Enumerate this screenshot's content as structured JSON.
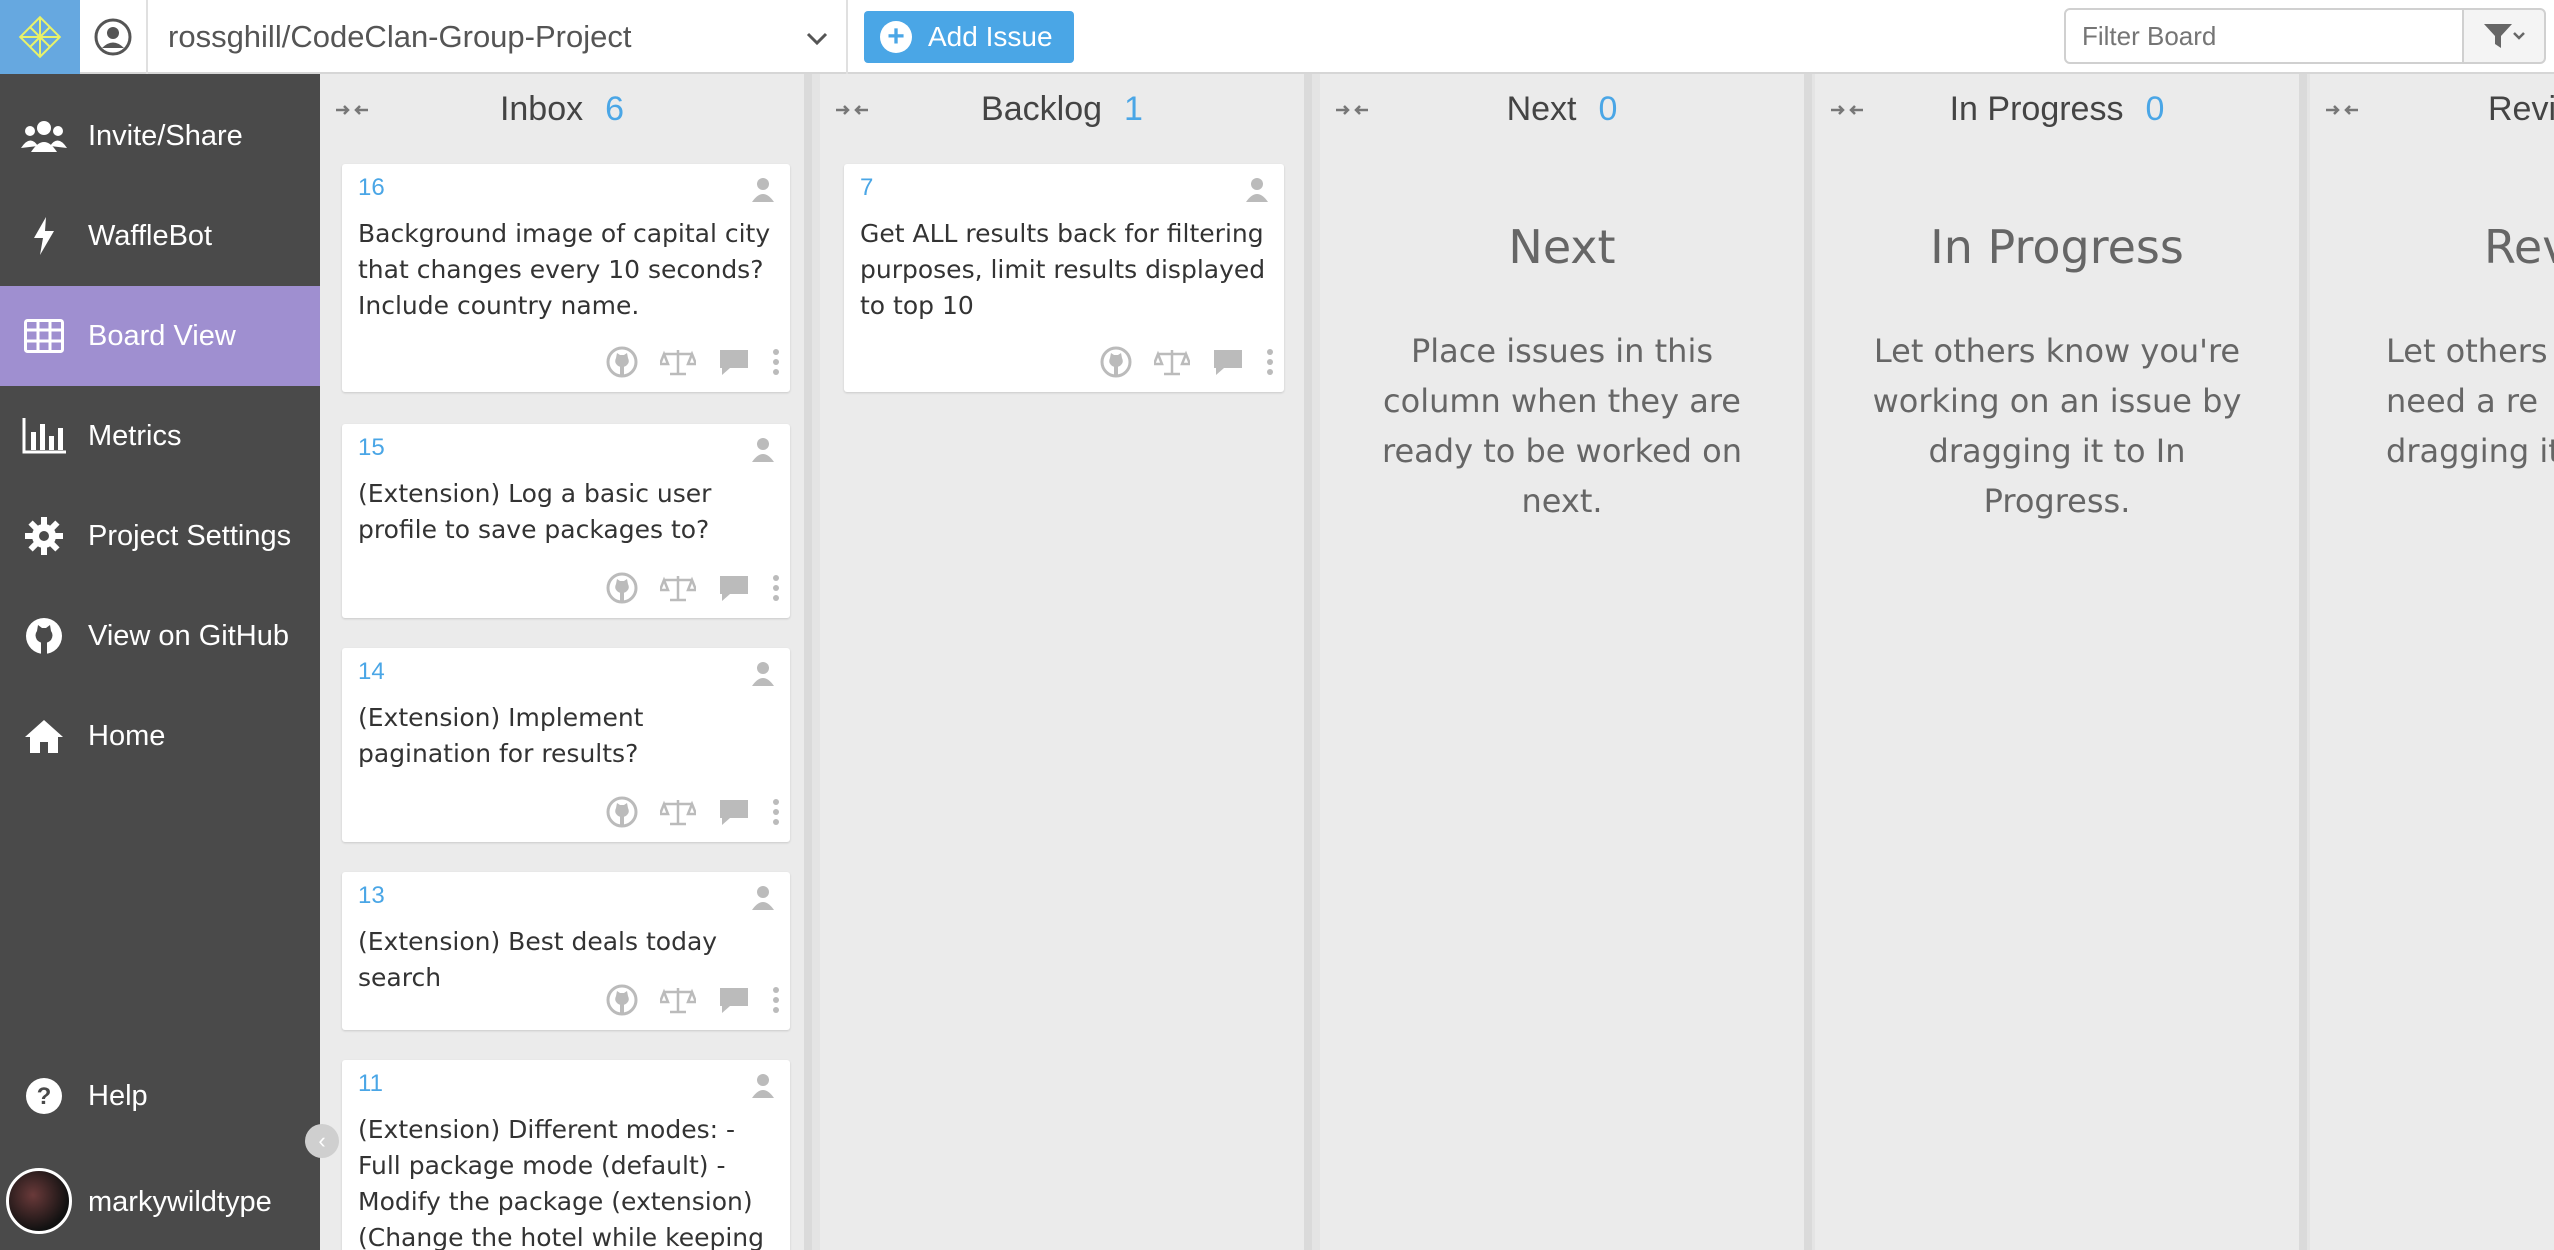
{
  "header": {
    "repo_name": "rossghill/CodeClan-Group-Project",
    "add_issue_label": "Add Issue",
    "filter_placeholder": "Filter Board"
  },
  "sidebar": {
    "items": [
      {
        "label": "Invite/Share",
        "icon": "users-icon"
      },
      {
        "label": "WaffleBot",
        "icon": "lightning-icon"
      },
      {
        "label": "Board View",
        "icon": "table-icon",
        "active": true
      },
      {
        "label": "Metrics",
        "icon": "bar-chart-icon"
      },
      {
        "label": "Project Settings",
        "icon": "gear-icon"
      },
      {
        "label": "View on GitHub",
        "icon": "github-icon"
      },
      {
        "label": "Home",
        "icon": "home-icon"
      }
    ],
    "help_label": "Help",
    "username": "markywildtype"
  },
  "columns": [
    {
      "name": "Inbox",
      "count": "6",
      "cards": [
        {
          "number": "16",
          "title": "Background image of capital city that changes every 10 seconds? Include country name."
        },
        {
          "number": "15",
          "title": "(Extension) Log a basic user profile to save packages to?"
        },
        {
          "number": "14",
          "title": "(Extension) Implement pagination for results?"
        },
        {
          "number": "13",
          "title": "(Extension) Best deals today search"
        },
        {
          "number": "11",
          "title": "(Extension) Different modes: - Full package mode (default) - Modify the package (extension) (Change the hotel while keeping the flight or"
        }
      ]
    },
    {
      "name": "Backlog",
      "count": "1",
      "cards": [
        {
          "number": "7",
          "title": "Get ALL results back for filtering purposes, limit results displayed to top 10"
        }
      ]
    },
    {
      "name": "Next",
      "count": "0",
      "empty_title": "Next",
      "empty_text": "Place issues in this column when they are ready to be worked on next."
    },
    {
      "name": "In Progress",
      "count": "0",
      "empty_title": "In Progress",
      "empty_text": "Let others know you're working on an issue by dragging it to In Progress."
    },
    {
      "name": "Revi",
      "empty_title": "Revi",
      "empty_text": "Let others need a re dragging it"
    }
  ],
  "colors": {
    "accent": "#4aa6e6",
    "active_nav": "#9f8fd0",
    "sidebar_bg": "#4a4a4a"
  }
}
